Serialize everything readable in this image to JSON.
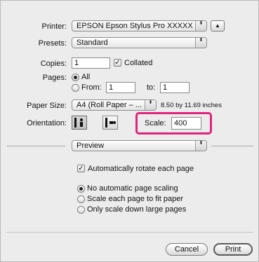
{
  "printer": {
    "label": "Printer:",
    "value": "EPSON Epson Stylus Pro XXXXX",
    "arrow": "⬍",
    "collapse_glyph": "▲"
  },
  "presets": {
    "label": "Presets:",
    "value": "Standard",
    "arrow": "⬍"
  },
  "copies": {
    "label": "Copies:",
    "value": "1",
    "collated_label": "Collated",
    "collated_checked": "✓"
  },
  "pages": {
    "label": "Pages:",
    "all_label": "All",
    "from_label": "From:",
    "from_value": "1",
    "to_label": "to:",
    "to_value": "1"
  },
  "paper_size": {
    "label": "Paper Size:",
    "value": "A4 (Roll Paper – ...",
    "arrow": "⬍",
    "dimensions": "8.50 by 11.69 inches"
  },
  "orientation": {
    "label": "Orientation:"
  },
  "scale": {
    "label": "Scale:",
    "value": "400"
  },
  "panel": {
    "value": "Preview",
    "arrow": "⬍"
  },
  "preview_options": {
    "auto_rotate_label": "Automatically rotate each page",
    "auto_rotate_check": "✓",
    "no_scaling_label": "No automatic page scaling",
    "fit_paper_label": "Scale each page to fit paper",
    "scale_down_label": "Only scale down large pages"
  },
  "buttons": {
    "cancel": "Cancel",
    "print": "Print"
  },
  "colors": {
    "highlight": "#e0247c"
  }
}
